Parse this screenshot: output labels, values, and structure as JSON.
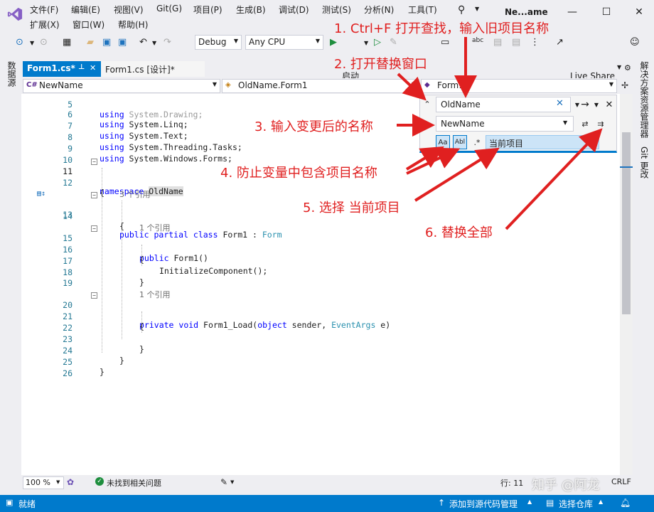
{
  "menu": {
    "row1": [
      "文件(F)",
      "编辑(E)",
      "视图(V)",
      "Git(G)",
      "项目(P)",
      "生成(B)",
      "调试(D)",
      "测试(S)",
      "分析(N)",
      "工具(T)"
    ],
    "row2": [
      "扩展(X)",
      "窗口(W)",
      "帮助(H)"
    ],
    "window_title": "Ne...ame"
  },
  "toolbar": {
    "config": "Debug",
    "platform": "Any CPU",
    "start_label": "启动",
    "live_share": "Live Share"
  },
  "left_strip": {
    "label": "数据源"
  },
  "right_strip": {
    "label1": "解决方案资源管理器",
    "label2": "Git 更改"
  },
  "tabs": [
    {
      "label": "Form1.cs*",
      "active": true
    },
    {
      "label": "Form1.cs [设计]*",
      "active": false
    }
  ],
  "nav": {
    "project": "NewName",
    "class": "OldName.Form1",
    "member": "Form1"
  },
  "code": {
    "lines": [
      {
        "n": "5",
        "text": "using System.Drawing;"
      },
      {
        "n": "6",
        "text": "using System.Linq;"
      },
      {
        "n": "7",
        "text": "using System.Text;"
      },
      {
        "n": "8",
        "text": "using System.Threading.Tasks;"
      },
      {
        "n": "9",
        "text": "using System.Windows.Forms;"
      },
      {
        "n": "10",
        "text": ""
      },
      {
        "n": "11",
        "text": "namespace OldName"
      },
      {
        "n": "12",
        "text": "{"
      },
      {
        "n": "",
        "text": "3 个引用"
      },
      {
        "n": "13",
        "text": "public partial class Form1 : Form"
      },
      {
        "n": "14",
        "text": "{"
      },
      {
        "n": "",
        "text": "1 个引用"
      },
      {
        "n": "15",
        "text": "public Form1()"
      },
      {
        "n": "16",
        "text": "{"
      },
      {
        "n": "17",
        "text": "InitializeComponent();"
      },
      {
        "n": "18",
        "text": "}"
      },
      {
        "n": "19",
        "text": ""
      },
      {
        "n": "",
        "text": "1 个引用"
      },
      {
        "n": "20",
        "text": "private void Form1_Load(object sender, EventArgs e)"
      },
      {
        "n": "21",
        "text": "{"
      },
      {
        "n": "22",
        "text": ""
      },
      {
        "n": "23",
        "text": "}"
      },
      {
        "n": "24",
        "text": "}"
      },
      {
        "n": "25",
        "text": "}"
      },
      {
        "n": "26",
        "text": ""
      }
    ]
  },
  "find": {
    "find_value": "OldName",
    "replace_value": "NewName",
    "scope": "当前项目",
    "match_case_label": "Aa",
    "whole_word_label": "Abl"
  },
  "bottom": {
    "zoom": "100 %",
    "issues": "未找到相关问题",
    "line": "行: 11",
    "eol": "CRLF"
  },
  "status": {
    "ready": "就绪",
    "add_source": "添加到源代码管理",
    "select_repo": "选择仓库"
  },
  "annotations": {
    "a1": "1. Ctrl+F 打开查找，输入旧项目名称",
    "a2": "2. 打开替换窗口",
    "a3": "3. 输入变更后的名称",
    "a4": "4. 防止变量中包含项目名称",
    "a5": "5. 选择 当前项目",
    "a6": "6. 替换全部"
  },
  "watermark": "知乎 @阿龙",
  "colors": {
    "accent": "#007acc",
    "annotation": "#e02020",
    "keyword": "#0000ff",
    "type": "#2b91af"
  }
}
